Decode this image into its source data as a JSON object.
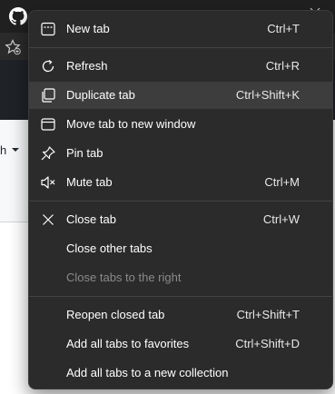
{
  "background": {
    "branch_text": "h"
  },
  "menu": {
    "items": [
      {
        "label": "New tab",
        "shortcut": "Ctrl+T",
        "icon": "new-tab-icon"
      },
      {
        "label": "Refresh",
        "shortcut": "Ctrl+R",
        "icon": "refresh-icon"
      },
      {
        "label": "Duplicate tab",
        "shortcut": "Ctrl+Shift+K",
        "icon": "duplicate-icon"
      },
      {
        "label": "Move tab to new window",
        "shortcut": "",
        "icon": "window-icon"
      },
      {
        "label": "Pin tab",
        "shortcut": "",
        "icon": "pin-icon"
      },
      {
        "label": "Mute tab",
        "shortcut": "Ctrl+M",
        "icon": "speaker-mute-icon"
      },
      {
        "label": "Close tab",
        "shortcut": "Ctrl+W",
        "icon": "close-icon"
      },
      {
        "label": "Close other tabs",
        "shortcut": ""
      },
      {
        "label": "Close tabs to the right",
        "shortcut": ""
      },
      {
        "label": "Reopen closed tab",
        "shortcut": "Ctrl+Shift+T"
      },
      {
        "label": "Add all tabs to favorites",
        "shortcut": "Ctrl+Shift+D"
      },
      {
        "label": "Add all tabs to a new collection",
        "shortcut": ""
      }
    ],
    "colors": {
      "background": "#2b2b2b",
      "highlight": "#3d3d3d",
      "text": "#ffffff",
      "disabled_text": "#8a8a8a"
    }
  }
}
